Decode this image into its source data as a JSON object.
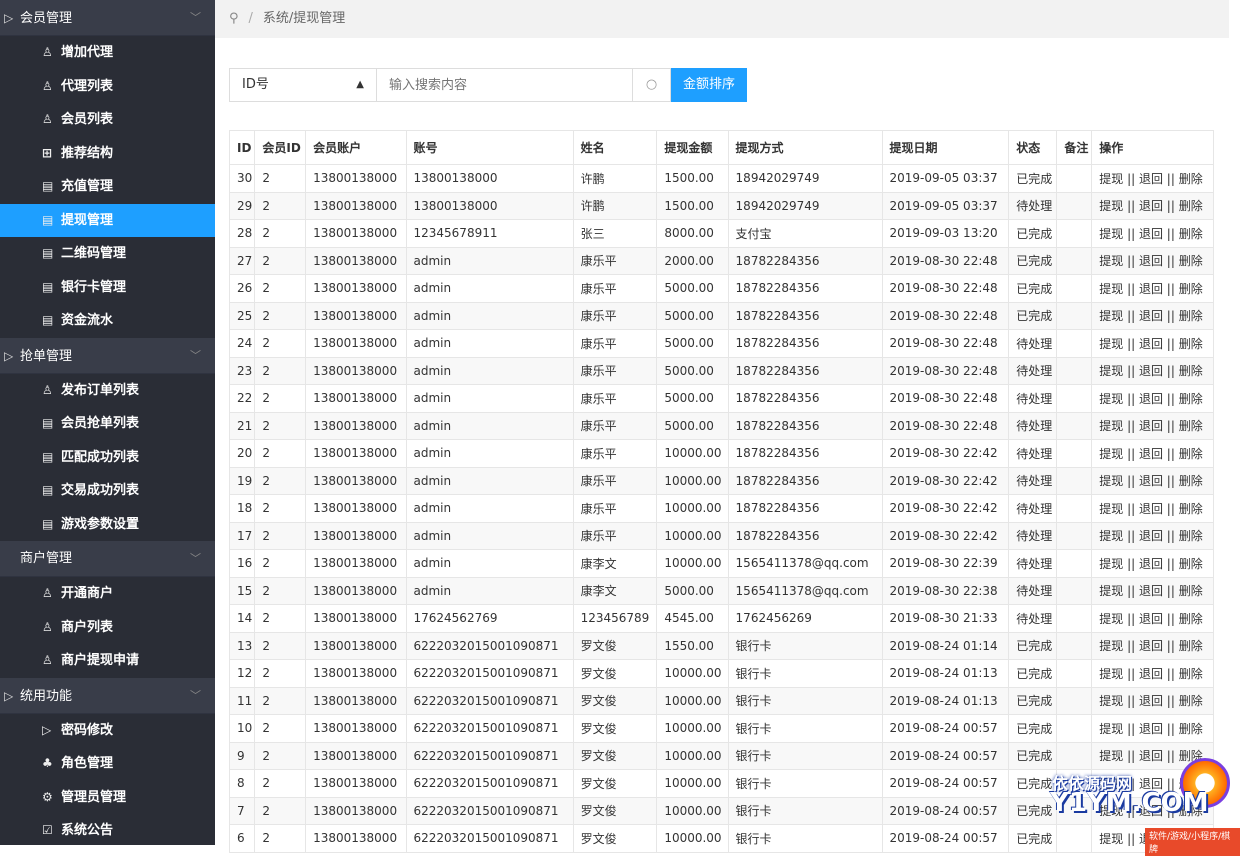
{
  "breadcrumb": {
    "text": "系统/提现管理"
  },
  "sidebar": {
    "groups": [
      {
        "label": "会员管理",
        "items": [
          {
            "label": "增加代理",
            "icon": "user-icon"
          },
          {
            "label": "代理列表",
            "icon": "user-icon"
          },
          {
            "label": "会员列表",
            "icon": "user-icon"
          },
          {
            "label": "推荐结构",
            "icon": "grid-icon"
          },
          {
            "label": "充值管理",
            "icon": "doc-icon"
          },
          {
            "label": "提现管理",
            "icon": "doc-icon",
            "active": true
          },
          {
            "label": "二维码管理",
            "icon": "doc-icon"
          },
          {
            "label": "银行卡管理",
            "icon": "doc-icon"
          },
          {
            "label": "资金流水",
            "icon": "doc-icon"
          }
        ]
      },
      {
        "label": "抢单管理",
        "items": [
          {
            "label": "发布订单列表",
            "icon": "user-icon"
          },
          {
            "label": "会员抢单列表",
            "icon": "doc-icon"
          },
          {
            "label": "匹配成功列表",
            "icon": "doc-icon"
          },
          {
            "label": "交易成功列表",
            "icon": "doc-icon"
          },
          {
            "label": "游戏参数设置",
            "icon": "doc-icon"
          }
        ]
      },
      {
        "label": "商户管理",
        "items": [
          {
            "label": "开通商户",
            "icon": "user-icon"
          },
          {
            "label": "商户列表",
            "icon": "user-icon"
          },
          {
            "label": "商户提现申请",
            "icon": "user-icon"
          }
        ]
      },
      {
        "label": "统用功能",
        "items": [
          {
            "label": "密码修改",
            "icon": "folder-icon"
          },
          {
            "label": "角色管理",
            "icon": "org-icon"
          },
          {
            "label": "管理员管理",
            "icon": "gear-icon"
          },
          {
            "label": "系统公告",
            "icon": "check-icon"
          }
        ]
      }
    ]
  },
  "search": {
    "select_value": "ID号",
    "placeholder": "输入搜索内容",
    "sort_button": "金额排序"
  },
  "table": {
    "headers": [
      "ID",
      "会员ID",
      "会员账户",
      "账号",
      "姓名",
      "提现金额",
      "提现方式",
      "提现日期",
      "状态",
      "备注",
      "操作"
    ],
    "ops": "提现 || 退回 || 删除",
    "rows": [
      [
        "30",
        "2",
        "13800138000",
        "13800138000",
        "许鹏",
        "1500.00",
        "18942029749",
        "2019-09-05 03:37",
        "已完成",
        ""
      ],
      [
        "29",
        "2",
        "13800138000",
        "13800138000",
        "许鹏",
        "1500.00",
        "18942029749",
        "2019-09-05 03:37",
        "待处理",
        ""
      ],
      [
        "28",
        "2",
        "13800138000",
        "12345678911",
        "张三",
        "8000.00",
        "支付宝",
        "2019-09-03 13:20",
        "已完成",
        ""
      ],
      [
        "27",
        "2",
        "13800138000",
        "admin",
        "康乐平",
        "2000.00",
        "18782284356",
        "2019-08-30 22:48",
        "已完成",
        ""
      ],
      [
        "26",
        "2",
        "13800138000",
        "admin",
        "康乐平",
        "5000.00",
        "18782284356",
        "2019-08-30 22:48",
        "已完成",
        ""
      ],
      [
        "25",
        "2",
        "13800138000",
        "admin",
        "康乐平",
        "5000.00",
        "18782284356",
        "2019-08-30 22:48",
        "已完成",
        ""
      ],
      [
        "24",
        "2",
        "13800138000",
        "admin",
        "康乐平",
        "5000.00",
        "18782284356",
        "2019-08-30 22:48",
        "待处理",
        ""
      ],
      [
        "23",
        "2",
        "13800138000",
        "admin",
        "康乐平",
        "5000.00",
        "18782284356",
        "2019-08-30 22:48",
        "待处理",
        ""
      ],
      [
        "22",
        "2",
        "13800138000",
        "admin",
        "康乐平",
        "5000.00",
        "18782284356",
        "2019-08-30 22:48",
        "待处理",
        ""
      ],
      [
        "21",
        "2",
        "13800138000",
        "admin",
        "康乐平",
        "5000.00",
        "18782284356",
        "2019-08-30 22:48",
        "待处理",
        ""
      ],
      [
        "20",
        "2",
        "13800138000",
        "admin",
        "康乐平",
        "10000.00",
        "18782284356",
        "2019-08-30 22:42",
        "待处理",
        ""
      ],
      [
        "19",
        "2",
        "13800138000",
        "admin",
        "康乐平",
        "10000.00",
        "18782284356",
        "2019-08-30 22:42",
        "待处理",
        ""
      ],
      [
        "18",
        "2",
        "13800138000",
        "admin",
        "康乐平",
        "10000.00",
        "18782284356",
        "2019-08-30 22:42",
        "待处理",
        ""
      ],
      [
        "17",
        "2",
        "13800138000",
        "admin",
        "康乐平",
        "10000.00",
        "18782284356",
        "2019-08-30 22:42",
        "待处理",
        ""
      ],
      [
        "16",
        "2",
        "13800138000",
        "admin",
        "康李文",
        "10000.00",
        "1565411378@qq.com",
        "2019-08-30 22:39",
        "待处理",
        ""
      ],
      [
        "15",
        "2",
        "13800138000",
        "admin",
        "康李文",
        "5000.00",
        "1565411378@qq.com",
        "2019-08-30 22:38",
        "待处理",
        ""
      ],
      [
        "14",
        "2",
        "13800138000",
        "17624562769",
        "123456789",
        "4545.00",
        "1762456269",
        "2019-08-30 21:33",
        "待处理",
        ""
      ],
      [
        "13",
        "2",
        "13800138000",
        "6222032015001090871",
        "罗文俊",
        "1550.00",
        "银行卡",
        "2019-08-24 01:14",
        "已完成",
        ""
      ],
      [
        "12",
        "2",
        "13800138000",
        "6222032015001090871",
        "罗文俊",
        "10000.00",
        "银行卡",
        "2019-08-24 01:13",
        "已完成",
        ""
      ],
      [
        "11",
        "2",
        "13800138000",
        "6222032015001090871",
        "罗文俊",
        "10000.00",
        "银行卡",
        "2019-08-24 01:13",
        "已完成",
        ""
      ],
      [
        "10",
        "2",
        "13800138000",
        "6222032015001090871",
        "罗文俊",
        "10000.00",
        "银行卡",
        "2019-08-24 00:57",
        "已完成",
        ""
      ],
      [
        "9",
        "2",
        "13800138000",
        "6222032015001090871",
        "罗文俊",
        "10000.00",
        "银行卡",
        "2019-08-24 00:57",
        "已完成",
        ""
      ],
      [
        "8",
        "2",
        "13800138000",
        "6222032015001090871",
        "罗文俊",
        "10000.00",
        "银行卡",
        "2019-08-24 00:57",
        "已完成",
        ""
      ],
      [
        "7",
        "2",
        "13800138000",
        "6222032015001090871",
        "罗文俊",
        "10000.00",
        "银行卡",
        "2019-08-24 00:57",
        "已完成",
        ""
      ],
      [
        "6",
        "2",
        "13800138000",
        "6222032015001090871",
        "罗文俊",
        "10000.00",
        "银行卡",
        "2019-08-24 00:57",
        "已完成",
        ""
      ]
    ]
  },
  "watermark": {
    "line1": "依依源码网",
    "line2": "Y1YM.COM",
    "line3": "软件/游戏/小程序/棋牌"
  },
  "colors": {
    "sidebar": "#393d49",
    "submenu": "#2a2d36",
    "accent": "#1e9fff"
  }
}
